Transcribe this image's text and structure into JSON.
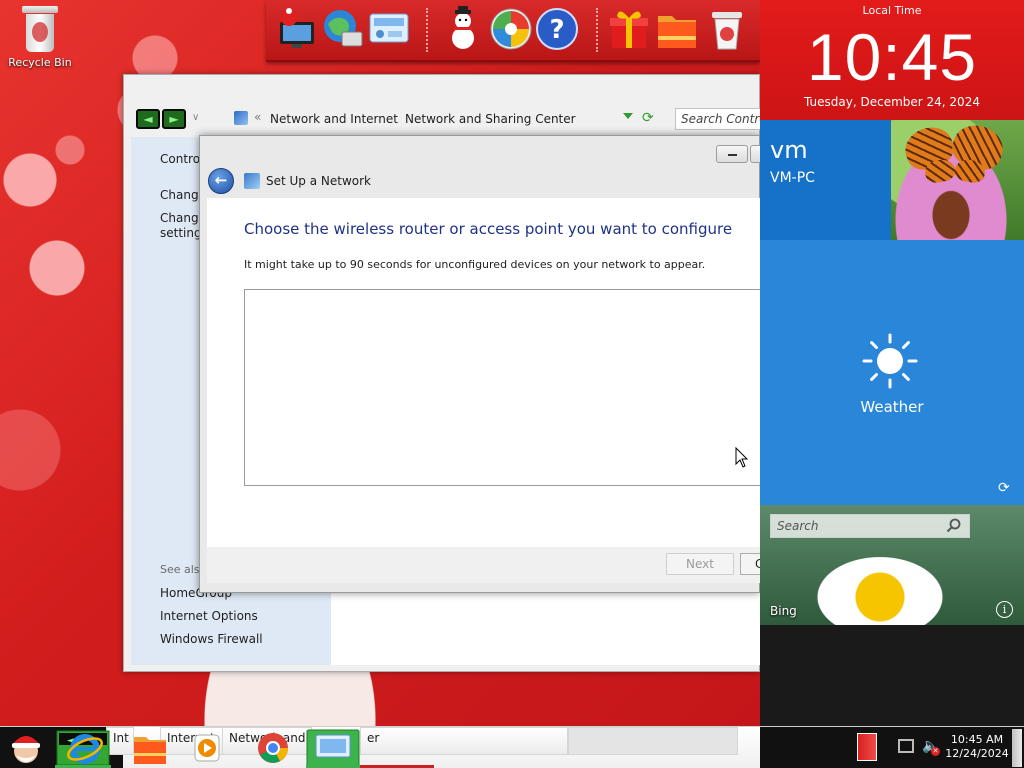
{
  "desktop": {
    "recycle_bin_label": "Recycle Bin"
  },
  "dock": {
    "items": [
      "santa-computer-icon",
      "globe-network-icon",
      "control-panel-icon",
      "snowman-icon",
      "windows-security-icon",
      "help-icon",
      "gift-icon",
      "folder-icon",
      "recycle-bin-icon"
    ]
  },
  "control_panel": {
    "breadcrumb": [
      "Network and Internet",
      "Network and Sharing Center"
    ],
    "search_placeholder": "Search Control",
    "sidebar": {
      "home_link": "Control",
      "links": [
        "Change",
        "Change",
        "settings"
      ],
      "see_also": "See also",
      "see_also_links": [
        "HomeGroup",
        "Internet Options",
        "Windows Firewall"
      ]
    }
  },
  "dialog": {
    "title": "Set Up a Network",
    "heading": "Choose the wireless router or access point you want to configure",
    "subtext": "It might take up to 90 seconds for unconfigured devices on your network to appear.",
    "next_label": "Next",
    "cancel_label": "C"
  },
  "panel": {
    "clock_label": "Local Time",
    "time": "10:45",
    "date": "Tuesday, December 24, 2024",
    "user_name": "vm",
    "computer_name": "VM-PC",
    "weather_label": "Weather",
    "bing_search_placeholder": "Search",
    "bing_label": "Bing",
    "info_glyph": "i"
  },
  "taskbar": {
    "buttons": [
      "Int",
      "Internet",
      "Network and S",
      "er"
    ],
    "clock_time": "10:45 AM",
    "clock_date": "12/24/2024"
  },
  "colors": {
    "desktop_red": "#d21d1d",
    "clock_tile": "#e31b1b",
    "user_tile": "#1672c9",
    "weather_tile": "#2a86d8",
    "dialog_heading": "#1e3287"
  }
}
